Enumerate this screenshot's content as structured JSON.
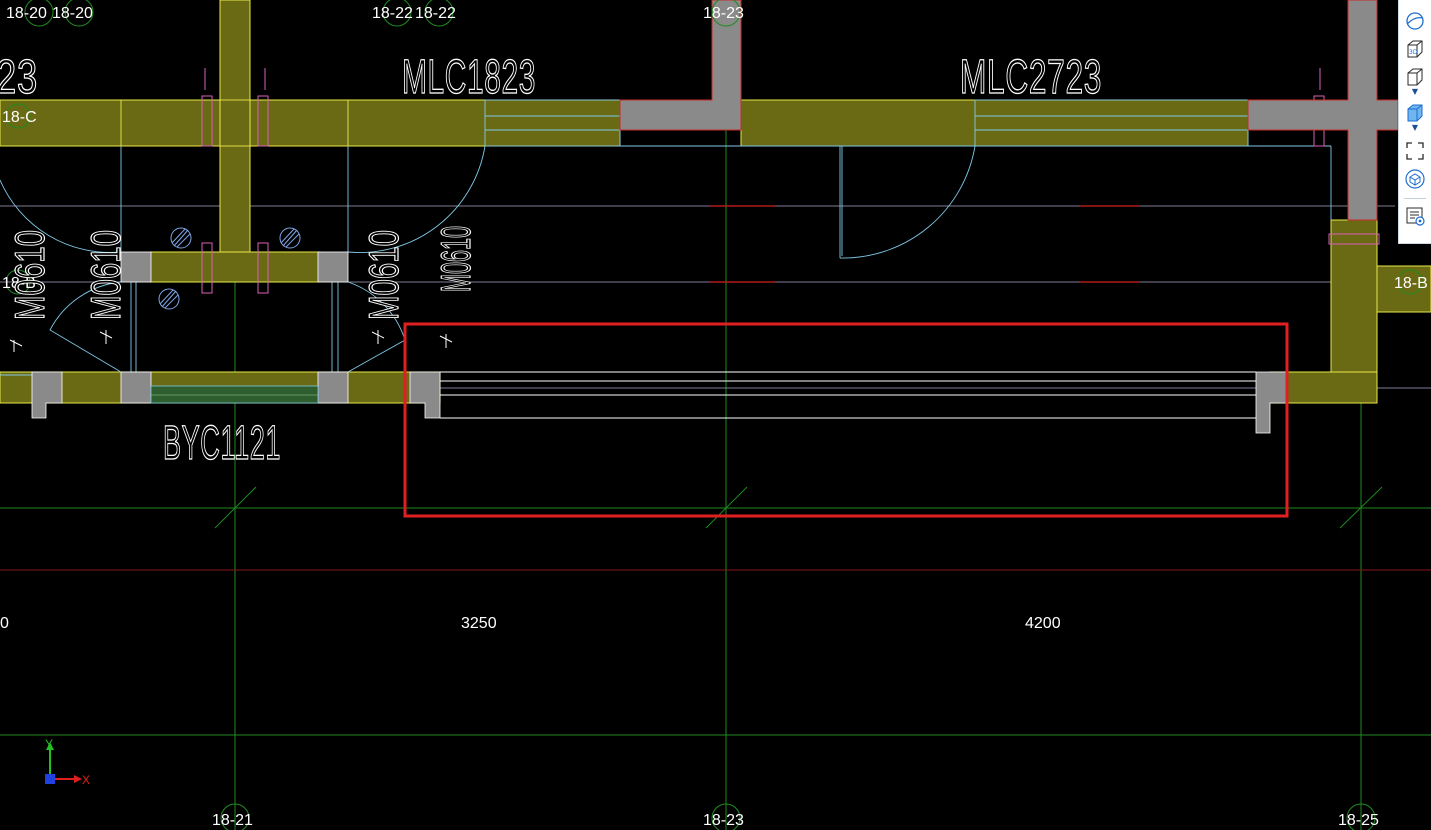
{
  "axes_top": [
    "18-20",
    "18-20",
    "18-22",
    "18-22",
    "18-23"
  ],
  "axes_bottom": [
    "18-21",
    "18-23",
    "18-25"
  ],
  "axes_side": {
    "left_c": "18-C",
    "left_b": "18-B",
    "right_b": "18-B"
  },
  "dimensions": [
    "0",
    "3250",
    "4200"
  ],
  "window_labels": {
    "left_partial": "23",
    "mlc1823": "MLC1823",
    "mlc2723": "MLC2723",
    "byc1121": "BYC1121"
  },
  "door_labels": {
    "m0610_left_partial": "M0610",
    "m0610_a": "M0610",
    "m0610_b": "M0610",
    "m0610_c": "M0610"
  },
  "ucs": {
    "x": "X",
    "y": "Y"
  },
  "toolbar": {
    "items": [
      {
        "name": "orbit",
        "icon": "orbit-icon"
      },
      {
        "name": "3d-view",
        "icon": "cube-3d-icon",
        "text": "3D"
      },
      {
        "name": "view-cube",
        "icon": "view-cube-icon"
      },
      {
        "name": "shaded-cube",
        "icon": "shaded-cube-icon"
      },
      {
        "name": "zoom-extents",
        "icon": "zoom-extents-icon"
      },
      {
        "name": "component-view",
        "icon": "component-icon"
      },
      {
        "name": "properties",
        "icon": "properties-icon"
      }
    ]
  },
  "colors": {
    "background": "#000000",
    "wall_fill": "#6b6a14",
    "wall_outline": "#e8e84a",
    "column_fill": "#8a8a8a",
    "axis_line": "#1f8a1f",
    "cyan_line": "#7fc8e6",
    "selection_box": "#e02020"
  }
}
